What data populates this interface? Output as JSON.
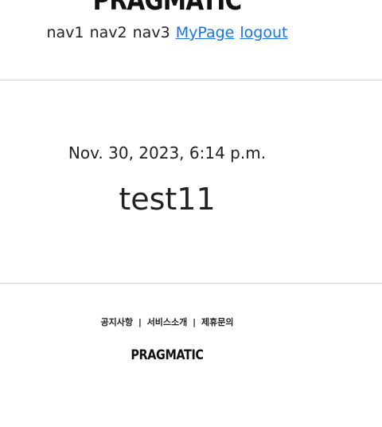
{
  "header": {
    "logo": "PRAGMATIC",
    "nav": {
      "nav1": "nav1",
      "nav2": "nav2",
      "nav3": "nav3",
      "mypage": "MyPage",
      "logout": "logout"
    }
  },
  "article": {
    "date": "Nov. 30, 2023, 6:14 p.m.",
    "title": "test11"
  },
  "footer": {
    "links": [
      "공지사항",
      "서비스소개",
      "제휴문의"
    ],
    "separator": "|",
    "logo": "PRAGMATIC"
  },
  "colors": {
    "link": "#1a73e8",
    "divider": "#cfcfcf"
  }
}
